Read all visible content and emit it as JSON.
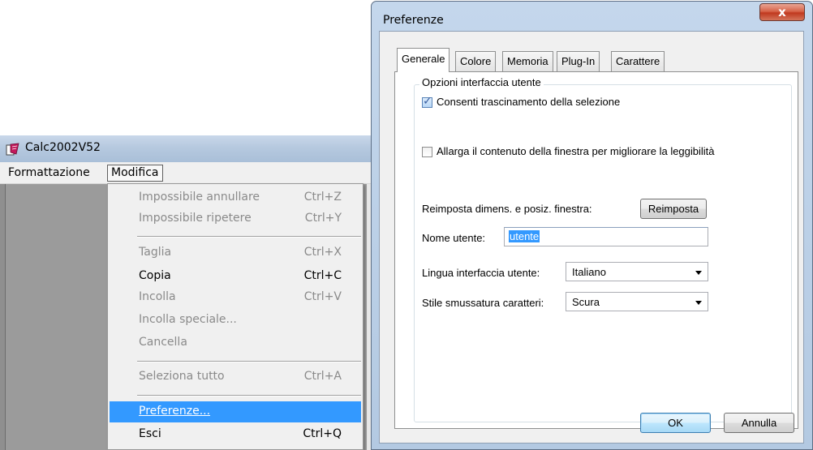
{
  "app": {
    "title": "Calc2002V52",
    "menu": {
      "formattazione": "Formattazione",
      "modifica": "Modifica"
    }
  },
  "dropdown": {
    "items": [
      {
        "label": "Impossibile annullare",
        "shortcut": "Ctrl+Z",
        "enabled": false
      },
      {
        "label": "Impossibile ripetere",
        "shortcut": "Ctrl+Y",
        "enabled": false
      },
      {
        "label": "Taglia",
        "shortcut": "Ctrl+X",
        "enabled": false
      },
      {
        "label": "Copia",
        "shortcut": "Ctrl+C",
        "enabled": true
      },
      {
        "label": "Incolla",
        "shortcut": "Ctrl+V",
        "enabled": false
      },
      {
        "label": "Incolla speciale...",
        "shortcut": "",
        "enabled": false
      },
      {
        "label": "Cancella",
        "shortcut": "",
        "enabled": false
      },
      {
        "label": "Seleziona tutto",
        "shortcut": "Ctrl+A",
        "enabled": false
      },
      {
        "label": "Preferenze...",
        "shortcut": "",
        "enabled": true,
        "highlighted": true
      },
      {
        "label": "Esci",
        "shortcut": "Ctrl+Q",
        "enabled": true
      }
    ]
  },
  "dialog": {
    "title": "Preferenze",
    "close_label": "x",
    "tabs": [
      {
        "label": "Generale",
        "active": true
      },
      {
        "label": "Colore"
      },
      {
        "label": "Memoria"
      },
      {
        "label": "Plug-In"
      },
      {
        "label": "Carattere"
      }
    ],
    "group_title": "Opzioni interfaccia utente",
    "checkbox_drag": {
      "label": "Consenti trascinamento della selezione",
      "checked": true
    },
    "checkbox_enlarge": {
      "label": "Allarga il contenuto della finestra per migliorare la leggibilità",
      "checked": false
    },
    "reset_label": "Reimposta dimens. e posiz. finestra:",
    "reset_button": "Reimposta",
    "username_label": "Nome utente:",
    "username_value": "utente",
    "language_label": "Lingua interfaccia utente:",
    "language_value": "Italiano",
    "smoothing_label": "Stile smussatura caratteri:",
    "smoothing_value": "Scura",
    "ok_button": "OK",
    "cancel_button": "Annulla"
  },
  "colors": {
    "highlight": "#3399ff",
    "dialog_frame": "#b3c9e2",
    "close_red": "#c0391f"
  }
}
